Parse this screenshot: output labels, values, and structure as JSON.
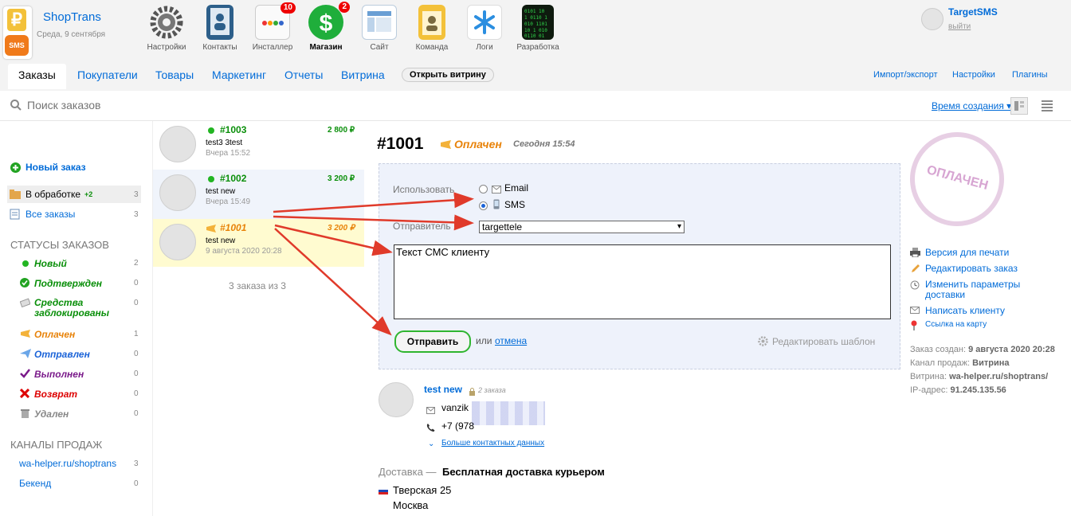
{
  "header": {
    "shop_name": "ShopTrans",
    "shop_date": "Среда, 9 сентября",
    "apps": [
      {
        "label": "Настройки",
        "icon": "gear-icon"
      },
      {
        "label": "Контакты",
        "icon": "contacts-book-icon"
      },
      {
        "label": "Инсталлер",
        "icon": "installer-icon",
        "badge": "10"
      },
      {
        "label": "Магазин",
        "icon": "dollar-icon",
        "badge": "2"
      },
      {
        "label": "Сайт",
        "icon": "site-icon"
      },
      {
        "label": "Команда",
        "icon": "team-badge-icon"
      },
      {
        "label": "Логи",
        "icon": "asterisk-icon"
      },
      {
        "label": "Разработка",
        "icon": "matrix-icon"
      }
    ],
    "user": {
      "name": "TargetSMS",
      "logout": "выйти"
    }
  },
  "tabs": {
    "items": [
      "Заказы",
      "Покупатели",
      "Товары",
      "Маркетинг",
      "Отчеты",
      "Витрина"
    ],
    "open_vitrine": "Открыть витрину",
    "right": [
      "Импорт/экспорт",
      "Настройки",
      "Плагины"
    ]
  },
  "search": {
    "placeholder": "Поиск заказов",
    "sort_label": "Время создания ▾"
  },
  "sidebar": {
    "new_order": "Новый заказ",
    "processing": "В обработке",
    "processing_badge": "+2",
    "processing_count": "3",
    "all_orders": "Все заказы",
    "all_count": "3",
    "statuses_header": "СТАТУСЫ ЗАКАЗОВ",
    "statuses": [
      {
        "label": "Новый",
        "count": "2",
        "color": "#0a8f0a"
      },
      {
        "label": "Подтвержден",
        "count": "0",
        "color": "#0a8f0a"
      },
      {
        "label": "Средства заблокированы",
        "count": "0",
        "color": "#0a8f0a"
      },
      {
        "label": "Оплачен",
        "count": "1",
        "color": "#e8830a"
      },
      {
        "label": "Отправлен",
        "count": "0",
        "color": "#1a63d8"
      },
      {
        "label": "Выполнен",
        "count": "0",
        "color": "#7a1a8a"
      },
      {
        "label": "Возврат",
        "count": "0",
        "color": "#d00"
      },
      {
        "label": "Удален",
        "count": "0",
        "color": "#888"
      }
    ],
    "channels_header": "КАНАЛЫ ПРОДАЖ",
    "channels": [
      {
        "label": "wa-helper.ru/shoptrans",
        "count": "3"
      },
      {
        "label": "Бекенд",
        "count": "0"
      }
    ]
  },
  "orders": [
    {
      "num": "#1003",
      "name": "test3 3test",
      "date": "Вчера 15:52",
      "sum": "2 800 ₽"
    },
    {
      "num": "#1002",
      "name": "test new",
      "date": "Вчера 15:49",
      "sum": "3 200 ₽"
    },
    {
      "num": "#1001",
      "name": "test new",
      "date": "9 августа 2020 20:28",
      "sum": "3 200 ₽"
    }
  ],
  "orders_count": "3 заказа из 3",
  "order": {
    "title": "#1001",
    "status": "Оплачен",
    "date": "Сегодня 15:54",
    "use_label": "Использовать",
    "opt_email": "Email",
    "opt_sms": "SMS",
    "sender_label": "Отправитель",
    "sender_value": "targettele",
    "sms_text": "Текст СМС клиенту",
    "send": "Отправить",
    "or": "или",
    "cancel": "отмена",
    "edit_template": "Редактировать шаблон",
    "customer": {
      "name": "test new",
      "orders": "2 заказа",
      "email": "vanzik",
      "phone": "+7 (978",
      "more": "Больше контактных данных"
    },
    "delivery_label": "Доставка —",
    "delivery_value": "Бесплатная доставка курьером",
    "address1": "Тверская 25",
    "address2": "Москва",
    "stamp": "ОПЛАЧЕН",
    "actions": [
      "Версия для печати",
      "Редактировать заказ",
      "Изменить параметры доставки",
      "Написать клиенту",
      "Ссылка на карту"
    ],
    "meta": {
      "created_label": "Заказ создан:",
      "created": "9 августа 2020 20:28",
      "channel_label": "Канал продаж:",
      "channel": "Витрина",
      "vitrine_label": "Витрина:",
      "vitrine": "wa-helper.ru/shoptrans/",
      "ip_label": "IP-адрес:",
      "ip": "91.245.135.56"
    }
  },
  "colors": {
    "link": "#006bd8",
    "green": "#0a8f0a",
    "paid": "#e8830a",
    "arrow": "#e03a2a"
  }
}
